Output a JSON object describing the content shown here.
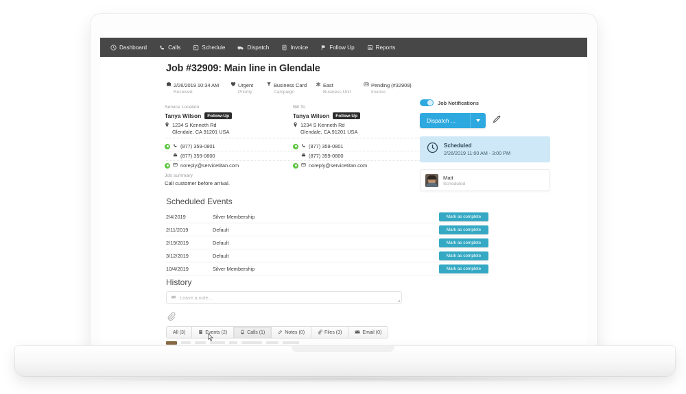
{
  "nav": {
    "items": [
      {
        "label": "Dashboard",
        "icon": "dashboard-icon"
      },
      {
        "label": "Calls",
        "icon": "phone-icon"
      },
      {
        "label": "Schedule",
        "icon": "calendar-icon"
      },
      {
        "label": "Dispatch",
        "icon": "truck-icon"
      },
      {
        "label": "Invoice",
        "icon": "document-icon"
      },
      {
        "label": "Follow Up",
        "icon": "flag-icon"
      },
      {
        "label": "Reports",
        "icon": "chart-icon"
      }
    ]
  },
  "job": {
    "title": "Job #32909: Main line in Glendale",
    "meta": [
      {
        "value": "2/26/2019 10:34 AM",
        "label": "Received",
        "icon": "inbox-icon"
      },
      {
        "value": "Urgent",
        "label": "Priority",
        "icon": "heart-icon"
      },
      {
        "value": "Business Card",
        "label": "Campaign",
        "icon": "funnel-icon"
      },
      {
        "value": "East",
        "label": "Business Unit",
        "icon": "asterisk-icon"
      },
      {
        "value": "Pending (#32909)",
        "label": "Invoice",
        "icon": "invoice-icon"
      }
    ]
  },
  "service_location": {
    "heading": "Service Location",
    "name": "Tanya Wilson",
    "badge": "Follow-Up",
    "address_line1": "1234 S Kenneth Rd",
    "address_line2": "Glendale, CA 91201 USA",
    "phone": "(877) 359-0801",
    "fax": "(877) 359-0800",
    "email": "noreply@servicetitan.com"
  },
  "bill_to": {
    "heading": "Bill To",
    "name": "Tanya Wilson",
    "badge": "Follow-Up",
    "address_line1": "1234 S Kenneth Rd",
    "address_line2": "Glendale, CA 91201 USA",
    "phone": "(877) 359-0801",
    "fax": "(877) 359-0800",
    "email": "noreply@servicetitan.com"
  },
  "summary": {
    "heading": "Job summary",
    "text": "Call customer before arrival."
  },
  "scheduled_events": {
    "title": "Scheduled Events",
    "action_label": "Mark as complete",
    "rows": [
      {
        "date": "2/4/2019",
        "type": "Silver Membership"
      },
      {
        "date": "2/11/2019",
        "type": "Default"
      },
      {
        "date": "2/19/2019",
        "type": "Default"
      },
      {
        "date": "3/12/2019",
        "type": "Default"
      },
      {
        "date": "10/4/2019",
        "type": "Silver Membership"
      }
    ]
  },
  "history": {
    "title": "History",
    "note_placeholder": "Leave a note...",
    "tabs": [
      {
        "label": "All (3)",
        "icon": null,
        "active": false
      },
      {
        "label": "Events (2)",
        "icon": "events-icon",
        "active": false
      },
      {
        "label": "Calls (1)",
        "icon": "calls-icon",
        "active": true
      },
      {
        "label": "Notes (0)",
        "icon": "notes-icon",
        "active": false
      },
      {
        "label": "Files (3)",
        "icon": "files-icon",
        "active": false
      },
      {
        "label": "Email (0)",
        "icon": "email-icon",
        "active": false
      }
    ]
  },
  "right_panel": {
    "notifications_label": "Job Notifications",
    "notifications_on": true,
    "dispatch_label": "Dispatch ...",
    "edit_icon": "pencil-icon",
    "scheduled_card": {
      "title": "Scheduled",
      "time": "2/26/2019 11:00 AM - 3:00 PM",
      "icon": "clock-icon"
    },
    "technician": {
      "name": "Matt",
      "status": "Scheduled"
    }
  },
  "colors": {
    "nav_bg": "#474747",
    "accent_blue": "#2ea9e0",
    "teal_button": "#35a9c4",
    "scheduled_card_bg": "#cfe8f7",
    "green_dot": "#5ec641"
  }
}
